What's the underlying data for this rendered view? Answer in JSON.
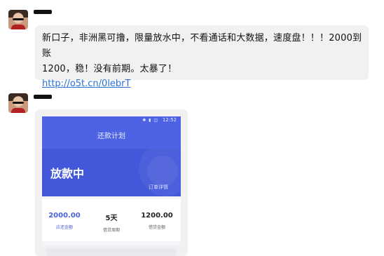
{
  "messages": [
    {
      "text_line1": "新口子，非洲黑可撸，限量放水中，不看通话和大数据，速度盘！！！2000到账",
      "text_line2": "1200，稳！没有前期。太暴了！",
      "link": "http://o5t.cn/0lebrT"
    }
  ],
  "screenshot": {
    "status_time": "12:52",
    "status_icons": "✱ ▮ ◫",
    "page_title": "还款计划",
    "status_title": "放款中",
    "detail_link": "订单详情",
    "stats": [
      {
        "value": "2000.00",
        "label": "应还金额"
      },
      {
        "value": "5天",
        "label": "借贷周期"
      },
      {
        "value": "1200.00",
        "label": "借贷金额"
      }
    ]
  },
  "colors": {
    "accent": "#4257d9",
    "link": "#2a6fd6",
    "bubble_bg": "#f1f1f1"
  }
}
